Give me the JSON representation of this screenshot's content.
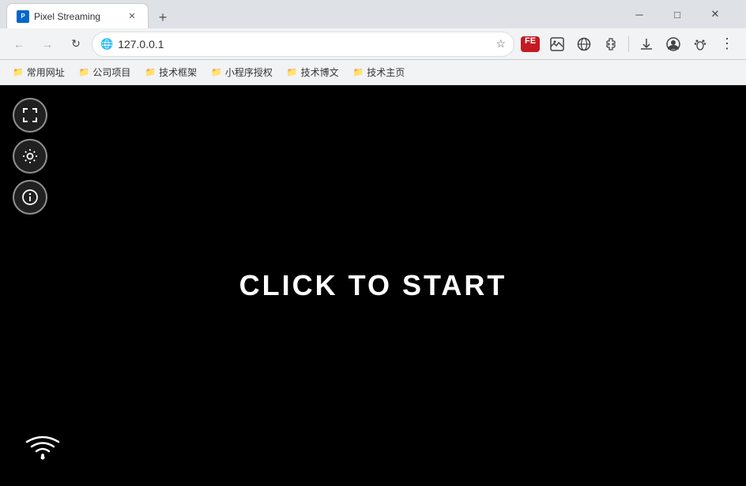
{
  "browser": {
    "title": "Pixel Streaming",
    "tab_title": "Pixel Streaming",
    "url": "127.0.0.1",
    "new_tab_label": "+",
    "close_label": "✕",
    "minimize_label": "─",
    "maximize_label": "□",
    "window_close_label": "✕"
  },
  "nav": {
    "back_label": "←",
    "forward_label": "→",
    "reload_label": "↻",
    "address_protocol": "🌐",
    "star_label": "☆"
  },
  "toolbar_actions": {
    "fe_label": "FE",
    "img_label": "⊞",
    "globe_label": "⊕",
    "extensions_label": "🧩",
    "download_label": "⬇",
    "profile_label": "◑",
    "paw_label": "🐾",
    "menu_label": "⋮"
  },
  "bookmarks": [
    {
      "label": "常用网址",
      "icon": "📁"
    },
    {
      "label": "公司项目",
      "icon": "📁"
    },
    {
      "label": "技术框架",
      "icon": "📁"
    },
    {
      "label": "小程序授权",
      "icon": "📁"
    },
    {
      "label": "技术博文",
      "icon": "📁"
    },
    {
      "label": "技术主页",
      "icon": "📁"
    }
  ],
  "content": {
    "click_to_start": "CLICK TO START"
  },
  "sidebar_controls": {
    "fullscreen_title": "Fullscreen",
    "settings_title": "Settings",
    "info_title": "Info"
  }
}
